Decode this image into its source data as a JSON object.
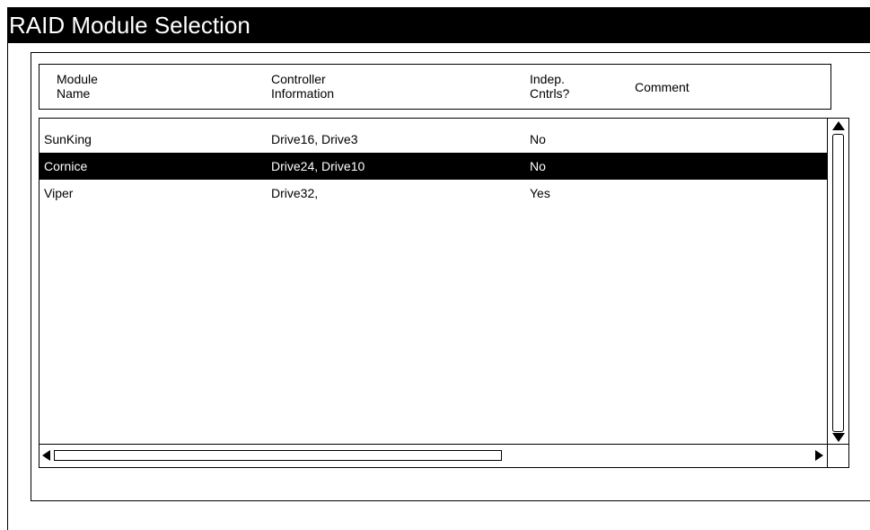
{
  "window": {
    "title": "RAID Module Selection"
  },
  "table": {
    "columns": [
      {
        "line1": "Module",
        "line2": "Name"
      },
      {
        "line1": "Controller",
        "line2": "Information"
      },
      {
        "line1": "Indep.",
        "line2": "Cntrls?"
      },
      {
        "line1": "Comment"
      }
    ],
    "rows": [
      {
        "name": "SunKing",
        "controllers": "Drive16, Drive3",
        "indep": "No",
        "comment": ""
      },
      {
        "name": "Cornice",
        "controllers": "Drive24, Drive10",
        "indep": "No",
        "comment": ""
      },
      {
        "name": "Viper",
        "controllers": "Drive32,",
        "indep": "Yes",
        "comment": ""
      }
    ],
    "selected_row": "Cornice"
  },
  "icons": {
    "scroll_up": "arrow-up-icon",
    "scroll_down": "arrow-down-icon",
    "scroll_left": "arrow-left-icon",
    "scroll_right": "arrow-right-icon"
  },
  "colors": {
    "title_bar": "#000000",
    "title_text": "#ffffff",
    "selection": "#000000"
  }
}
